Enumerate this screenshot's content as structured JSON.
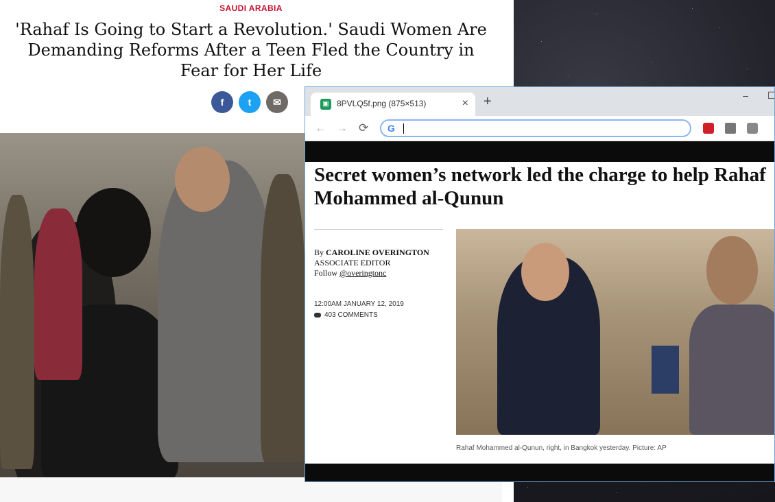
{
  "article_bg": {
    "kicker": "SAUDI ARABIA",
    "headline": "'Rahaf Is Going to Start a Revolution.' Saudi Women Are Demanding Reforms After a Teen Fled the Country in Fear for Her Life",
    "share": {
      "facebook": "f",
      "twitter": "t",
      "email": "✉"
    },
    "photo_alt": "Rahaf Mohammed al-Qunun with officials at airport"
  },
  "browser": {
    "tab_title": "8PVLQ5f.png (875×513)",
    "close_glyph": "×",
    "newtab_glyph": "+",
    "minimize_glyph": "–",
    "maximize_glyph": "☐",
    "address_value": "",
    "nav": {
      "back": "←",
      "forward": "→",
      "reload": "⟳"
    },
    "google_glyph": "G"
  },
  "inner_article": {
    "title": "Secret women’s network led the charge to help Rahaf\nMohammed al-Qunun",
    "by_label": "By",
    "author": "CAROLINE OVERINGTON",
    "role": "ASSOCIATE EDITOR",
    "follow_label": "Follow",
    "follow_handle": "@overingtonc",
    "timestamp": "12:00AM JANUARY 12, 2019",
    "comments": "403 COMMENTS",
    "caption": "Rahaf Mohammed al-Qunun, right, in Bangkok yesterday. Picture: AP"
  }
}
